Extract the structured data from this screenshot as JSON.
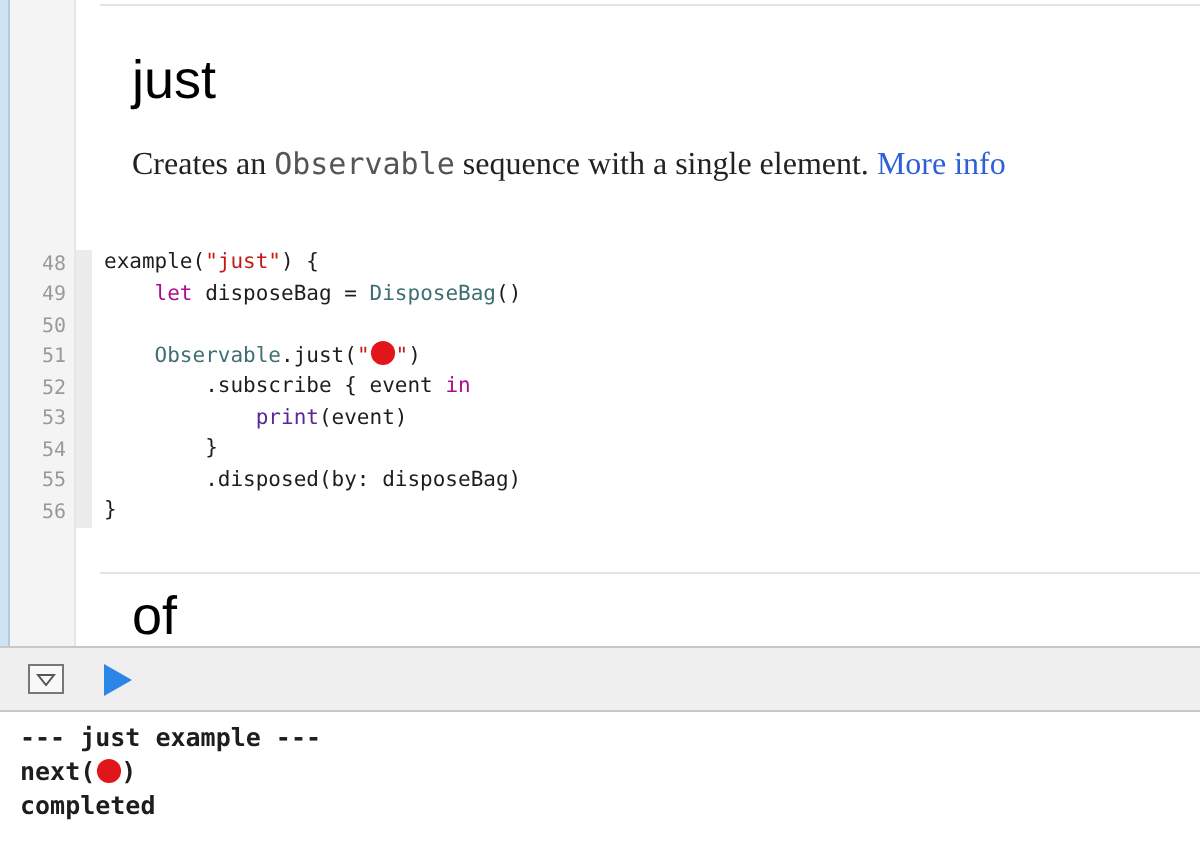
{
  "section": {
    "title": "just",
    "description": [
      {
        "kind": "text",
        "text": "Creates an "
      },
      {
        "kind": "code",
        "text": "Observable"
      },
      {
        "kind": "text",
        "text": " sequence with a single element. "
      },
      {
        "kind": "link",
        "text": "More info"
      }
    ]
  },
  "code": [
    {
      "number": "48",
      "tokens": [
        {
          "kind": "plain",
          "text": "example("
        },
        {
          "kind": "string",
          "text": "\"just\""
        },
        {
          "kind": "plain",
          "text": ") {"
        }
      ]
    },
    {
      "number": "49",
      "tokens": [
        {
          "kind": "keyword",
          "text": "    let"
        },
        {
          "kind": "plain",
          "text": " disposeBag = "
        },
        {
          "kind": "type",
          "text": "DisposeBag"
        },
        {
          "kind": "plain",
          "text": "()"
        }
      ]
    },
    {
      "number": "50"
    },
    {
      "number": "51",
      "tokens": [
        {
          "kind": "type",
          "text": "    Observable"
        },
        {
          "kind": "plain",
          "text": ".just("
        },
        {
          "kind": "string",
          "text": "\""
        },
        {
          "kind": "ball"
        },
        {
          "kind": "string",
          "text": "\""
        },
        {
          "kind": "plain",
          "text": ")"
        }
      ]
    },
    {
      "number": "52",
      "tokens": [
        {
          "kind": "plain",
          "text": "        .subscribe { event "
        },
        {
          "kind": "keyword",
          "text": "in"
        }
      ]
    },
    {
      "number": "53",
      "tokens": [
        {
          "kind": "func",
          "text": "            print"
        },
        {
          "kind": "plain",
          "text": "(event)"
        }
      ]
    },
    {
      "number": "54",
      "tokens": [
        {
          "kind": "plain",
          "text": "        }"
        }
      ]
    },
    {
      "number": "55",
      "tokens": [
        {
          "kind": "plain",
          "text": "        .disposed(by: disposeBag)"
        }
      ]
    },
    {
      "number": "56",
      "tokens": [
        {
          "kind": "plain",
          "text": "}"
        }
      ]
    }
  ],
  "next_section": {
    "title": "of"
  },
  "console": [
    {
      "tokens": [
        {
          "kind": "plain",
          "text": "--- just example ---"
        }
      ]
    },
    {
      "tokens": [
        {
          "kind": "plain",
          "text": "next("
        },
        {
          "kind": "ball"
        },
        {
          "kind": "plain",
          "text": ")"
        }
      ]
    },
    {
      "tokens": [
        {
          "kind": "plain",
          "text": "completed"
        }
      ]
    }
  ]
}
